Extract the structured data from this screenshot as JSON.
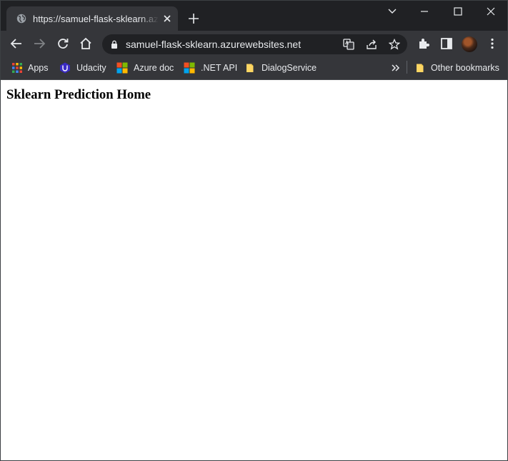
{
  "browser": {
    "tab": {
      "title": "https://samuel-flask-sklearn.azurewebsites.net"
    },
    "address_bar": {
      "url": "samuel-flask-sklearn.azurewebsites.net"
    },
    "bookmarks": [
      {
        "label": "Apps",
        "icon": "apps-grid-icon"
      },
      {
        "label": "Udacity",
        "icon": "udacity-icon"
      },
      {
        "label": "Azure doc",
        "icon": "microsoft-icon"
      },
      {
        "label": ".NET API",
        "icon": "microsoft-icon"
      },
      {
        "label": "DialogService",
        "icon": "folder-icon"
      }
    ],
    "other_bookmarks": "Other bookmarks",
    "colors": {
      "frame": "#202124",
      "toolbar": "#35363a",
      "text": "#e8eaed",
      "page_bg": "#ffffff"
    }
  },
  "page": {
    "heading": "Sklearn Prediction Home"
  }
}
